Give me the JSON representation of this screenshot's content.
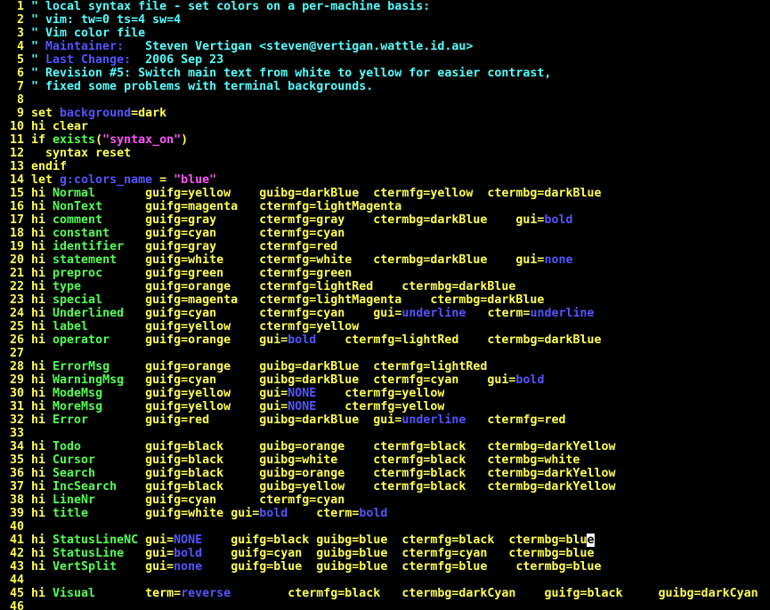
{
  "window": {
    "title": ""
  },
  "editor": {
    "colors": {
      "line_number": "#ffff54",
      "text": "#ffff54",
      "comment": "#54ffff",
      "special": "#5454ff",
      "string": "#ff54ff",
      "type": "#54ff54",
      "cursor_bg": "#ffffff",
      "background": "#000000"
    },
    "lines": [
      {
        "n": "1",
        "segs": [
          [
            "\" local syntax file - set colors on a per-machine basis:",
            "c"
          ]
        ]
      },
      {
        "n": "2",
        "segs": [
          [
            "\" vim: tw=0 ts=4 sw=4",
            "c"
          ]
        ]
      },
      {
        "n": "3",
        "segs": [
          [
            "\" Vim color file",
            "c"
          ]
        ]
      },
      {
        "n": "4",
        "segs": [
          [
            "\" ",
            "c"
          ],
          [
            "Maintainer:",
            "p"
          ],
          [
            "   Steven Vertigan <steven@vertigan.wattle.id.au>",
            "c"
          ]
        ]
      },
      {
        "n": "5",
        "segs": [
          [
            "\" ",
            "c"
          ],
          [
            "Last Change:",
            "p"
          ],
          [
            "  2006 Sep 23",
            "c"
          ]
        ]
      },
      {
        "n": "6",
        "segs": [
          [
            "\" Revision #5: Switch main text from white to yellow for easier contrast,",
            "c"
          ]
        ]
      },
      {
        "n": "7",
        "segs": [
          [
            "\" fixed some problems with terminal backgrounds.",
            "c"
          ]
        ]
      },
      {
        "n": "8",
        "segs": []
      },
      {
        "n": "9",
        "segs": [
          [
            "set ",
            "t"
          ],
          [
            "background",
            "p"
          ],
          [
            "=dark",
            "t"
          ]
        ]
      },
      {
        "n": "10",
        "segs": [
          [
            "hi clear",
            "t"
          ]
        ]
      },
      {
        "n": "11",
        "segs": [
          [
            "if ",
            "t"
          ],
          [
            "exists",
            "y"
          ],
          [
            "(",
            "t"
          ],
          [
            "\"syntax_on\"",
            "s"
          ],
          [
            ")",
            "t"
          ]
        ]
      },
      {
        "n": "12",
        "segs": [
          [
            "  syntax reset",
            "t"
          ]
        ]
      },
      {
        "n": "13",
        "segs": [
          [
            "endif",
            "t"
          ]
        ]
      },
      {
        "n": "14",
        "segs": [
          [
            "let ",
            "t"
          ],
          [
            "g:colors_name",
            "p"
          ],
          [
            " = ",
            "t"
          ],
          [
            "\"blue\"",
            "s"
          ]
        ]
      },
      {
        "n": "15",
        "segs": [
          [
            "hi ",
            "t"
          ],
          [
            "Normal       ",
            "y"
          ],
          [
            "guifg=yellow    guibg=darkBlue  ",
            "t"
          ],
          [
            "ctermfg=yellow  ctermbg=darkBlue",
            "t"
          ]
        ]
      },
      {
        "n": "16",
        "segs": [
          [
            "hi ",
            "t"
          ],
          [
            "NonText      ",
            "y"
          ],
          [
            "guifg=magenta   ctermfg=lightMagenta",
            "t"
          ]
        ]
      },
      {
        "n": "17",
        "segs": [
          [
            "hi ",
            "t"
          ],
          [
            "comment      ",
            "y"
          ],
          [
            "guifg=gray      ctermfg=gray    ctermbg=darkBlue    ",
            "t"
          ],
          [
            "gui",
            "t"
          ],
          [
            "=",
            "t"
          ],
          [
            "bold",
            "p"
          ]
        ]
      },
      {
        "n": "18",
        "segs": [
          [
            "hi ",
            "t"
          ],
          [
            "constant     ",
            "y"
          ],
          [
            "guifg=cyan      ctermfg=cyan",
            "t"
          ]
        ]
      },
      {
        "n": "19",
        "segs": [
          [
            "hi ",
            "t"
          ],
          [
            "identifier   ",
            "y"
          ],
          [
            "guifg=gray      ctermfg=red",
            "t"
          ]
        ]
      },
      {
        "n": "20",
        "segs": [
          [
            "hi ",
            "t"
          ],
          [
            "statement    ",
            "y"
          ],
          [
            "guifg=white     ctermfg=white   ctermbg=darkBlue    ",
            "t"
          ],
          [
            "gui",
            "t"
          ],
          [
            "=",
            "t"
          ],
          [
            "none",
            "p"
          ]
        ]
      },
      {
        "n": "21",
        "segs": [
          [
            "hi ",
            "t"
          ],
          [
            "preproc      ",
            "y"
          ],
          [
            "guifg=green     ctermfg=green",
            "t"
          ]
        ]
      },
      {
        "n": "22",
        "segs": [
          [
            "hi ",
            "t"
          ],
          [
            "type         ",
            "y"
          ],
          [
            "guifg=orange    ctermfg=lightRed    ctermbg=darkBlue",
            "t"
          ]
        ]
      },
      {
        "n": "23",
        "segs": [
          [
            "hi ",
            "t"
          ],
          [
            "special      ",
            "y"
          ],
          [
            "guifg=magenta   ctermfg=lightMagenta    ctermbg=darkBlue",
            "t"
          ]
        ]
      },
      {
        "n": "24",
        "segs": [
          [
            "hi ",
            "t"
          ],
          [
            "Underlined   ",
            "y"
          ],
          [
            "guifg=cyan      ctermfg=cyan    ",
            "t"
          ],
          [
            "gui",
            "t"
          ],
          [
            "=",
            "t"
          ],
          [
            "underline",
            "p"
          ],
          [
            "   ",
            "t"
          ],
          [
            "cterm",
            "t"
          ],
          [
            "=",
            "t"
          ],
          [
            "underline",
            "p"
          ]
        ]
      },
      {
        "n": "25",
        "segs": [
          [
            "hi ",
            "t"
          ],
          [
            "label        ",
            "y"
          ],
          [
            "guifg=yellow    ctermfg=yellow",
            "t"
          ]
        ]
      },
      {
        "n": "26",
        "segs": [
          [
            "hi ",
            "t"
          ],
          [
            "operator     ",
            "y"
          ],
          [
            "guifg=orange    ",
            "t"
          ],
          [
            "gui",
            "t"
          ],
          [
            "=",
            "t"
          ],
          [
            "bold",
            "p"
          ],
          [
            "    ctermfg=lightRed    ctermbg=darkBlue",
            "t"
          ]
        ]
      },
      {
        "n": "27",
        "segs": []
      },
      {
        "n": "28",
        "segs": [
          [
            "hi ",
            "t"
          ],
          [
            "ErrorMsg     ",
            "y"
          ],
          [
            "guifg=orange    guibg=darkBlue  ctermfg=lightRed",
            "t"
          ]
        ]
      },
      {
        "n": "29",
        "segs": [
          [
            "hi ",
            "t"
          ],
          [
            "WarningMsg   ",
            "y"
          ],
          [
            "guifg=cyan      guibg=darkBlue  ctermfg=cyan    ",
            "t"
          ],
          [
            "gui",
            "t"
          ],
          [
            "=",
            "t"
          ],
          [
            "bold",
            "p"
          ]
        ]
      },
      {
        "n": "30",
        "segs": [
          [
            "hi ",
            "t"
          ],
          [
            "ModeMsg      ",
            "y"
          ],
          [
            "guifg=yellow    ",
            "t"
          ],
          [
            "gui",
            "t"
          ],
          [
            "=",
            "t"
          ],
          [
            "NONE",
            "p"
          ],
          [
            "    ctermfg=yellow",
            "t"
          ]
        ]
      },
      {
        "n": "31",
        "segs": [
          [
            "hi ",
            "t"
          ],
          [
            "MoreMsg      ",
            "y"
          ],
          [
            "guifg=yellow    ",
            "t"
          ],
          [
            "gui",
            "t"
          ],
          [
            "=",
            "t"
          ],
          [
            "NONE",
            "p"
          ],
          [
            "    ctermfg=yellow",
            "t"
          ]
        ]
      },
      {
        "n": "32",
        "segs": [
          [
            "hi ",
            "t"
          ],
          [
            "Error        ",
            "y"
          ],
          [
            "guifg=red       guibg=darkBlue  ",
            "t"
          ],
          [
            "gui",
            "t"
          ],
          [
            "=",
            "t"
          ],
          [
            "underline",
            "p"
          ],
          [
            "   ctermfg=red",
            "t"
          ]
        ]
      },
      {
        "n": "33",
        "segs": []
      },
      {
        "n": "34",
        "segs": [
          [
            "hi ",
            "t"
          ],
          [
            "Todo         ",
            "y"
          ],
          [
            "guifg=black     guibg=orange    ctermfg=black   ctermbg=darkYellow",
            "t"
          ]
        ]
      },
      {
        "n": "35",
        "segs": [
          [
            "hi ",
            "t"
          ],
          [
            "Cursor       ",
            "y"
          ],
          [
            "guifg=black     guibg=white     ctermfg=black   ctermbg=white",
            "t"
          ]
        ]
      },
      {
        "n": "36",
        "segs": [
          [
            "hi ",
            "t"
          ],
          [
            "Search       ",
            "y"
          ],
          [
            "guifg=black     guibg=orange    ctermfg=black   ctermbg=darkYellow",
            "t"
          ]
        ]
      },
      {
        "n": "37",
        "segs": [
          [
            "hi ",
            "t"
          ],
          [
            "IncSearch    ",
            "y"
          ],
          [
            "guifg=black     guibg=yellow    ctermfg=black   ctermbg=darkYellow",
            "t"
          ]
        ]
      },
      {
        "n": "38",
        "segs": [
          [
            "hi ",
            "t"
          ],
          [
            "LineNr       ",
            "y"
          ],
          [
            "guifg=cyan      ctermfg=cyan",
            "t"
          ]
        ]
      },
      {
        "n": "39",
        "segs": [
          [
            "hi ",
            "t"
          ],
          [
            "title        ",
            "y"
          ],
          [
            "guifg=white ",
            "t"
          ],
          [
            "gui",
            "t"
          ],
          [
            "=",
            "t"
          ],
          [
            "bold",
            "p"
          ],
          [
            "    ",
            "t"
          ],
          [
            "cterm",
            "t"
          ],
          [
            "=",
            "t"
          ],
          [
            "bold",
            "p"
          ]
        ]
      },
      {
        "n": "40",
        "segs": []
      },
      {
        "n": "41",
        "segs": [
          [
            "hi ",
            "t"
          ],
          [
            "StatusLineNC ",
            "y"
          ],
          [
            "gui",
            "t"
          ],
          [
            "=",
            "t"
          ],
          [
            "NONE",
            "p"
          ],
          [
            "    guifg=black guibg=blue  ctermfg=black  ctermbg=blu",
            "t"
          ],
          [
            "e",
            "k"
          ]
        ]
      },
      {
        "n": "42",
        "segs": [
          [
            "hi ",
            "t"
          ],
          [
            "StatusLine   ",
            "y"
          ],
          [
            "gui",
            "t"
          ],
          [
            "=",
            "t"
          ],
          [
            "bold",
            "p"
          ],
          [
            "    guifg=cyan  guibg=blue  ctermfg=cyan   ctermbg=blue",
            "t"
          ]
        ]
      },
      {
        "n": "43",
        "segs": [
          [
            "hi ",
            "t"
          ],
          [
            "VertSplit    ",
            "y"
          ],
          [
            "gui",
            "t"
          ],
          [
            "=",
            "t"
          ],
          [
            "none",
            "p"
          ],
          [
            "    guifg=blue  guibg=blue  ctermfg=blue    ctermbg=blue",
            "t"
          ]
        ]
      },
      {
        "n": "44",
        "segs": []
      },
      {
        "n": "45",
        "segs": [
          [
            "hi ",
            "t"
          ],
          [
            "Visual       ",
            "y"
          ],
          [
            "term",
            "t"
          ],
          [
            "=",
            "t"
          ],
          [
            "reverse",
            "p"
          ],
          [
            "        ctermfg=black   ctermbg=darkCyan    guifg=black     guibg=darkCyan",
            "t"
          ]
        ]
      },
      {
        "n": "46",
        "segs": []
      }
    ]
  }
}
